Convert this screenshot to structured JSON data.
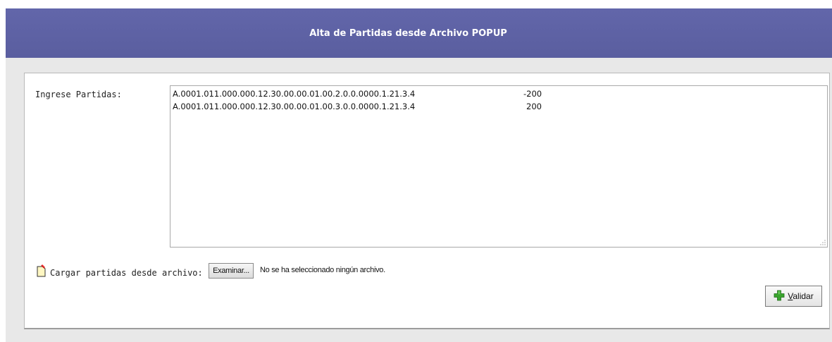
{
  "header": {
    "title": "Alta de Partidas desde Archivo POPUP"
  },
  "form": {
    "partidas_label": "Ingrese Partidas:",
    "partidas_lines": [
      {
        "code": "A.0001.011.000.000.12.30.00.00.01.00.2.0.0.0000.1.21.3.4",
        "value": "-200"
      },
      {
        "code": "A.0001.011.000.000.12.30.00.00.01.00.3.0.0.0000.1.21.3.4",
        "value": "200"
      }
    ],
    "cargar_label": "Cargar partidas desde archivo:",
    "examinar_label": "Examinar...",
    "no_file_text": "No se ha seleccionado ningún archivo.",
    "validar_first": "V",
    "validar_rest": "alidar"
  },
  "icons": {
    "file": "file-upload-icon",
    "validar": "green-plus-icon"
  },
  "colors": {
    "header_bg": "#5f63a6",
    "outer_bg": "#e8e8e8",
    "plus_green": "#3aa52e"
  }
}
